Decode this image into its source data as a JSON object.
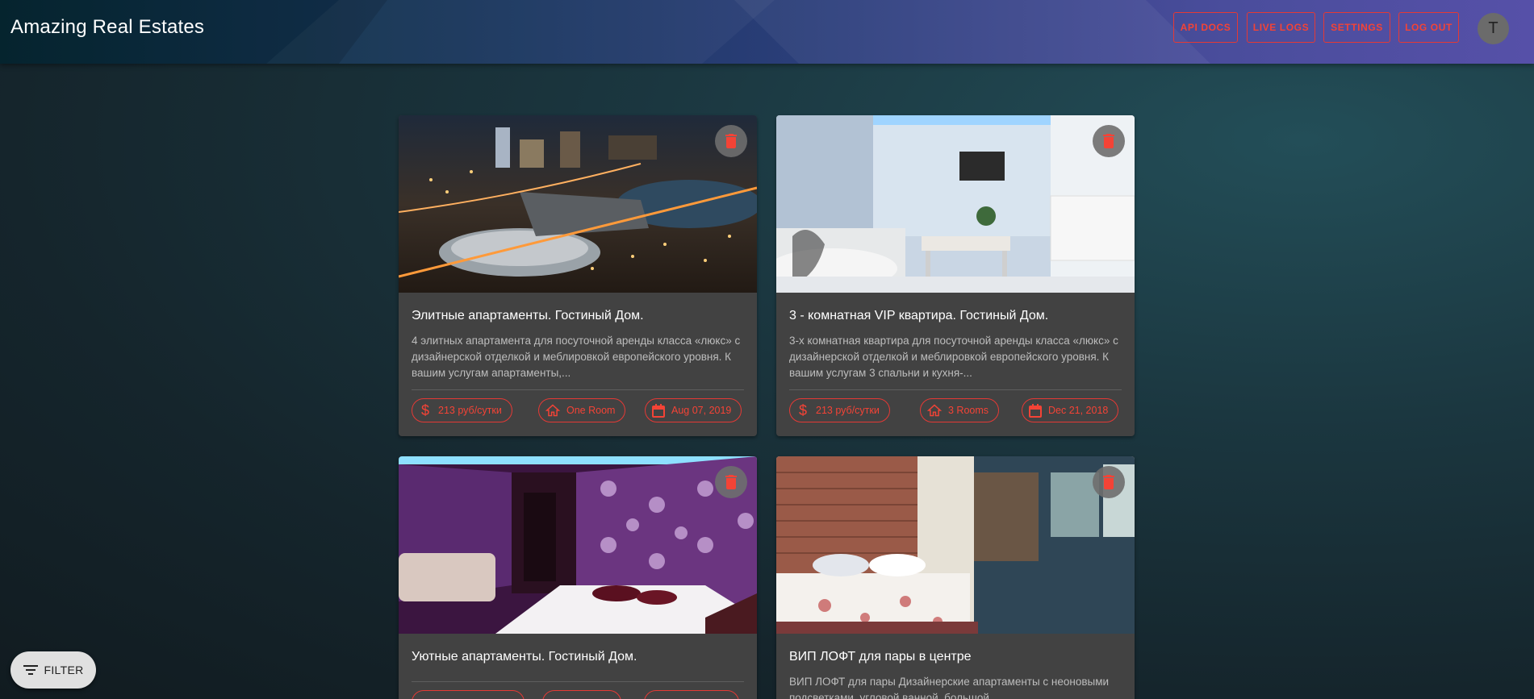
{
  "app": {
    "title": "Amazing Real Estates"
  },
  "nav": {
    "api_docs": "API DOCS",
    "live_logs": "LIVE LOGS",
    "settings": "SETTINGS",
    "log_out": "LOG OUT",
    "avatar_initial": "T"
  },
  "colors": {
    "accent": "#f44336",
    "card": "#424242",
    "appbar_start": "#062a35",
    "appbar_end": "#5650a8"
  },
  "listings": [
    {
      "title": "Элитные апартаменты. Гостиный Дом.",
      "description": "4 элитных апартамента для посуточной аренды класса «люкс» с дизайнерской отделкой и меблировкой европейского уровня. К вашим услугам апартаменты,...",
      "price": "213  руб/сутки",
      "rooms": "One Room",
      "date": "Aug 07, 2019",
      "photo_icon": "night-city-photo"
    },
    {
      "title": "3 - комнатная VIP квартира. Гостиный Дом.",
      "description": "3-х комнатная квартира для посуточной аренды класса «люкс» с дизайнерской отделкой и меблировкой европейского уровня. К вашим услугам 3 спальни и кухня-...",
      "price": "213  руб/сутки",
      "rooms": "3 Rooms",
      "date": "Dec 21, 2018",
      "photo_icon": "living-room-photo"
    },
    {
      "title": "Уютные апартаменты. Гостиный Дом.",
      "description": "",
      "photo_icon": "purple-bedroom-photo"
    },
    {
      "title": "ВИП ЛОФТ для пары в центре",
      "description": "ВИП ЛОФТ для пары Дизайнерские апартаменты с неоновыми подсветками, угловой ванной, большой",
      "photo_icon": "loft-bedroom-photo"
    }
  ],
  "filter": {
    "label": "FILTER"
  }
}
